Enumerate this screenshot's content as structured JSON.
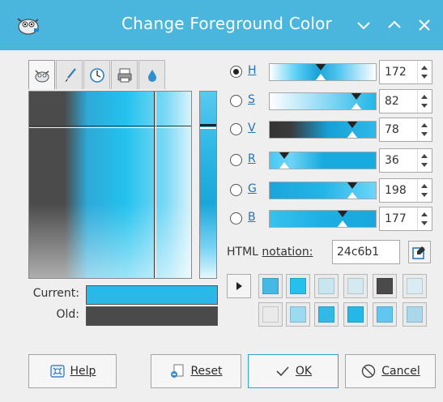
{
  "window": {
    "title": "Change Foreground Color",
    "controls": [
      "chevron-down-icon",
      "chevron-up-icon",
      "close-icon"
    ]
  },
  "selector_tabs": [
    "gimp-icon",
    "brush-icon",
    "clock-icon",
    "printer-icon",
    "water-drop-icon"
  ],
  "preview": {
    "current_label": "Current:",
    "old_label": "Old:",
    "current_color": "#24c6b1",
    "old_color": "#4a4a4a"
  },
  "channels": [
    {
      "key": "H",
      "label": "H",
      "value": "172",
      "checked": true,
      "level": 0.48,
      "gradient": "linear-gradient(to right, #ffffff 0%, #5bd0f6 25%, #1aa3d8 45%, #52c5ef 65%, #ffffff 100%)"
    },
    {
      "key": "S",
      "label": "S",
      "value": "82",
      "checked": false,
      "level": 0.82,
      "gradient": "linear-gradient(to right, #ffffff 0%, #a7e2f7 40%, #22b6e6 100%)"
    },
    {
      "key": "V",
      "label": "V",
      "value": "78",
      "checked": false,
      "level": 0.78,
      "gradient": "linear-gradient(to right, #333333 0%, #3b3b3b 20%, #16a0d6 55%, #2fb9ea 100%)"
    },
    {
      "key": "R",
      "label": "R",
      "value": "36",
      "checked": false,
      "level": 0.14,
      "gradient": "linear-gradient(to right, #47c9f3 0%, #6fd4f6 20%, #17abe0 50%, #17abe0 100%)"
    },
    {
      "key": "G",
      "label": "G",
      "value": "198",
      "checked": false,
      "level": 0.78,
      "gradient": "linear-gradient(to right, #1aa6dc 0%, #23b4e8 50%, #6dd5f7 100%)"
    },
    {
      "key": "B",
      "label": "B",
      "value": "177",
      "checked": false,
      "level": 0.69,
      "gradient": "linear-gradient(to right, #36c2ee 0%, #1db0e4 50%, #1aa6dc 100%)"
    }
  ],
  "html_notation": {
    "label": "HTML notation:",
    "value": "24c6b1"
  },
  "history": {
    "row1": [
      "#43b9e3",
      "#24c1ec",
      "#c9e6f0",
      "#d4e9f0",
      "#4a4a4a",
      "#d8ecf2"
    ],
    "row2": [
      "#eaeaea",
      "#9cdaf2",
      "#31b9e8",
      "#25b6ea",
      "#60c8f0",
      "#aad8ea"
    ]
  },
  "buttons": {
    "help": "Help",
    "reset": "Reset",
    "ok": "OK",
    "cancel": "Cancel"
  }
}
